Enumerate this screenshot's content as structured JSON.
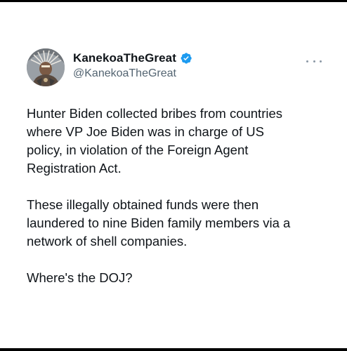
{
  "tweet": {
    "author": {
      "display_name": "KanekoaTheGreat",
      "handle": "@KanekoaTheGreat",
      "verified": true,
      "avatar_icon": "profile-avatar"
    },
    "more_icon": "more-dots-icon",
    "paragraphs": [
      {
        "lines": [
          "Hunter Biden collected bribes from countries",
          "where VP Joe Biden was in charge of US",
          "policy, in violation of the Foreign Agent",
          "Registration Act."
        ]
      },
      {
        "lines": [
          "These illegally obtained funds were then",
          "laundered to nine Biden family members via a",
          "network of shell companies."
        ]
      },
      {
        "lines": [
          "Where's the DOJ?"
        ]
      }
    ]
  },
  "colors": {
    "text": "#0f1419",
    "secondary_text": "#536471",
    "verified_badge": "#1d9bf0",
    "background": "#ffffff"
  }
}
